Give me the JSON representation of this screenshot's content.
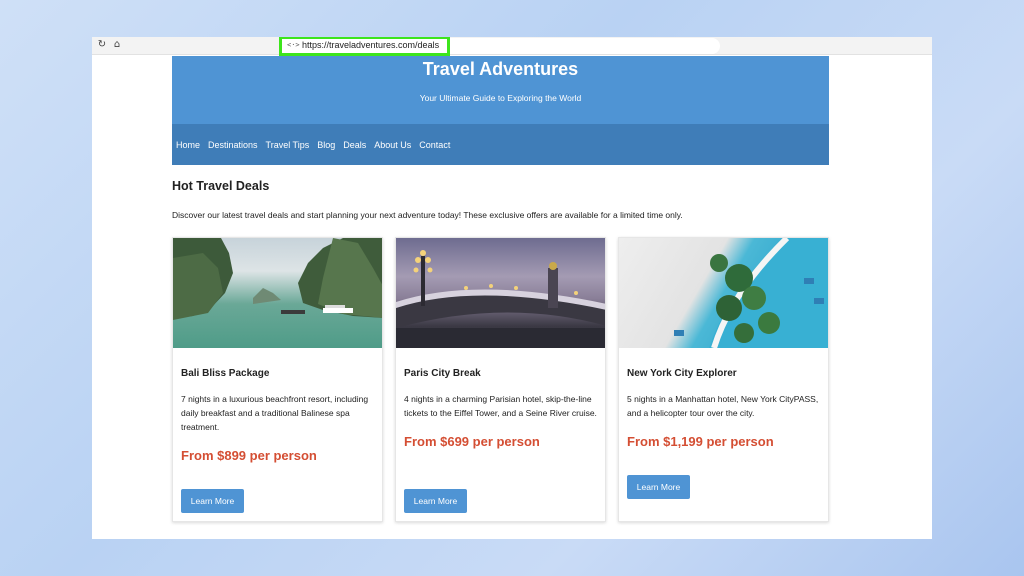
{
  "browser": {
    "reload_icon": "↻",
    "home_icon": "⌂",
    "site_icon": "<·>",
    "url": "https://traveladventures.com/deals"
  },
  "header": {
    "title": "Travel Adventures",
    "tagline": "Your Ultimate Guide to Exploring the World"
  },
  "nav": {
    "items": [
      "Home",
      "Destinations",
      "Travel Tips",
      "Blog",
      "Deals",
      "About Us",
      "Contact"
    ]
  },
  "main": {
    "section_title": "Hot Travel Deals",
    "intro": "Discover our latest travel deals and start planning your next adventure today! These exclusive offers are available for a limited time only."
  },
  "deals": [
    {
      "title": "Bali Bliss Package",
      "description": "7 nights in a luxurious beachfront resort, including daily breakfast and a traditional Balinese spa treatment.",
      "price": "From $899 per person",
      "button": "Learn More"
    },
    {
      "title": "Paris City Break",
      "description": "4 nights in a charming Parisian hotel, skip-the-line tickets to the Eiffel Tower, and a Seine River cruise.",
      "price": "From $699 per person",
      "button": "Learn More"
    },
    {
      "title": "New York City Explorer",
      "description": "5 nights in a Manhattan hotel, New York CityPASS, and a helicopter tour over the city.",
      "price": "From $1,199 per person",
      "button": "Learn More"
    }
  ],
  "colors": {
    "header_blue": "#4f94d4",
    "nav_blue": "#3f7db8",
    "price_red": "#d44e33",
    "url_highlight": "#3de51c"
  }
}
